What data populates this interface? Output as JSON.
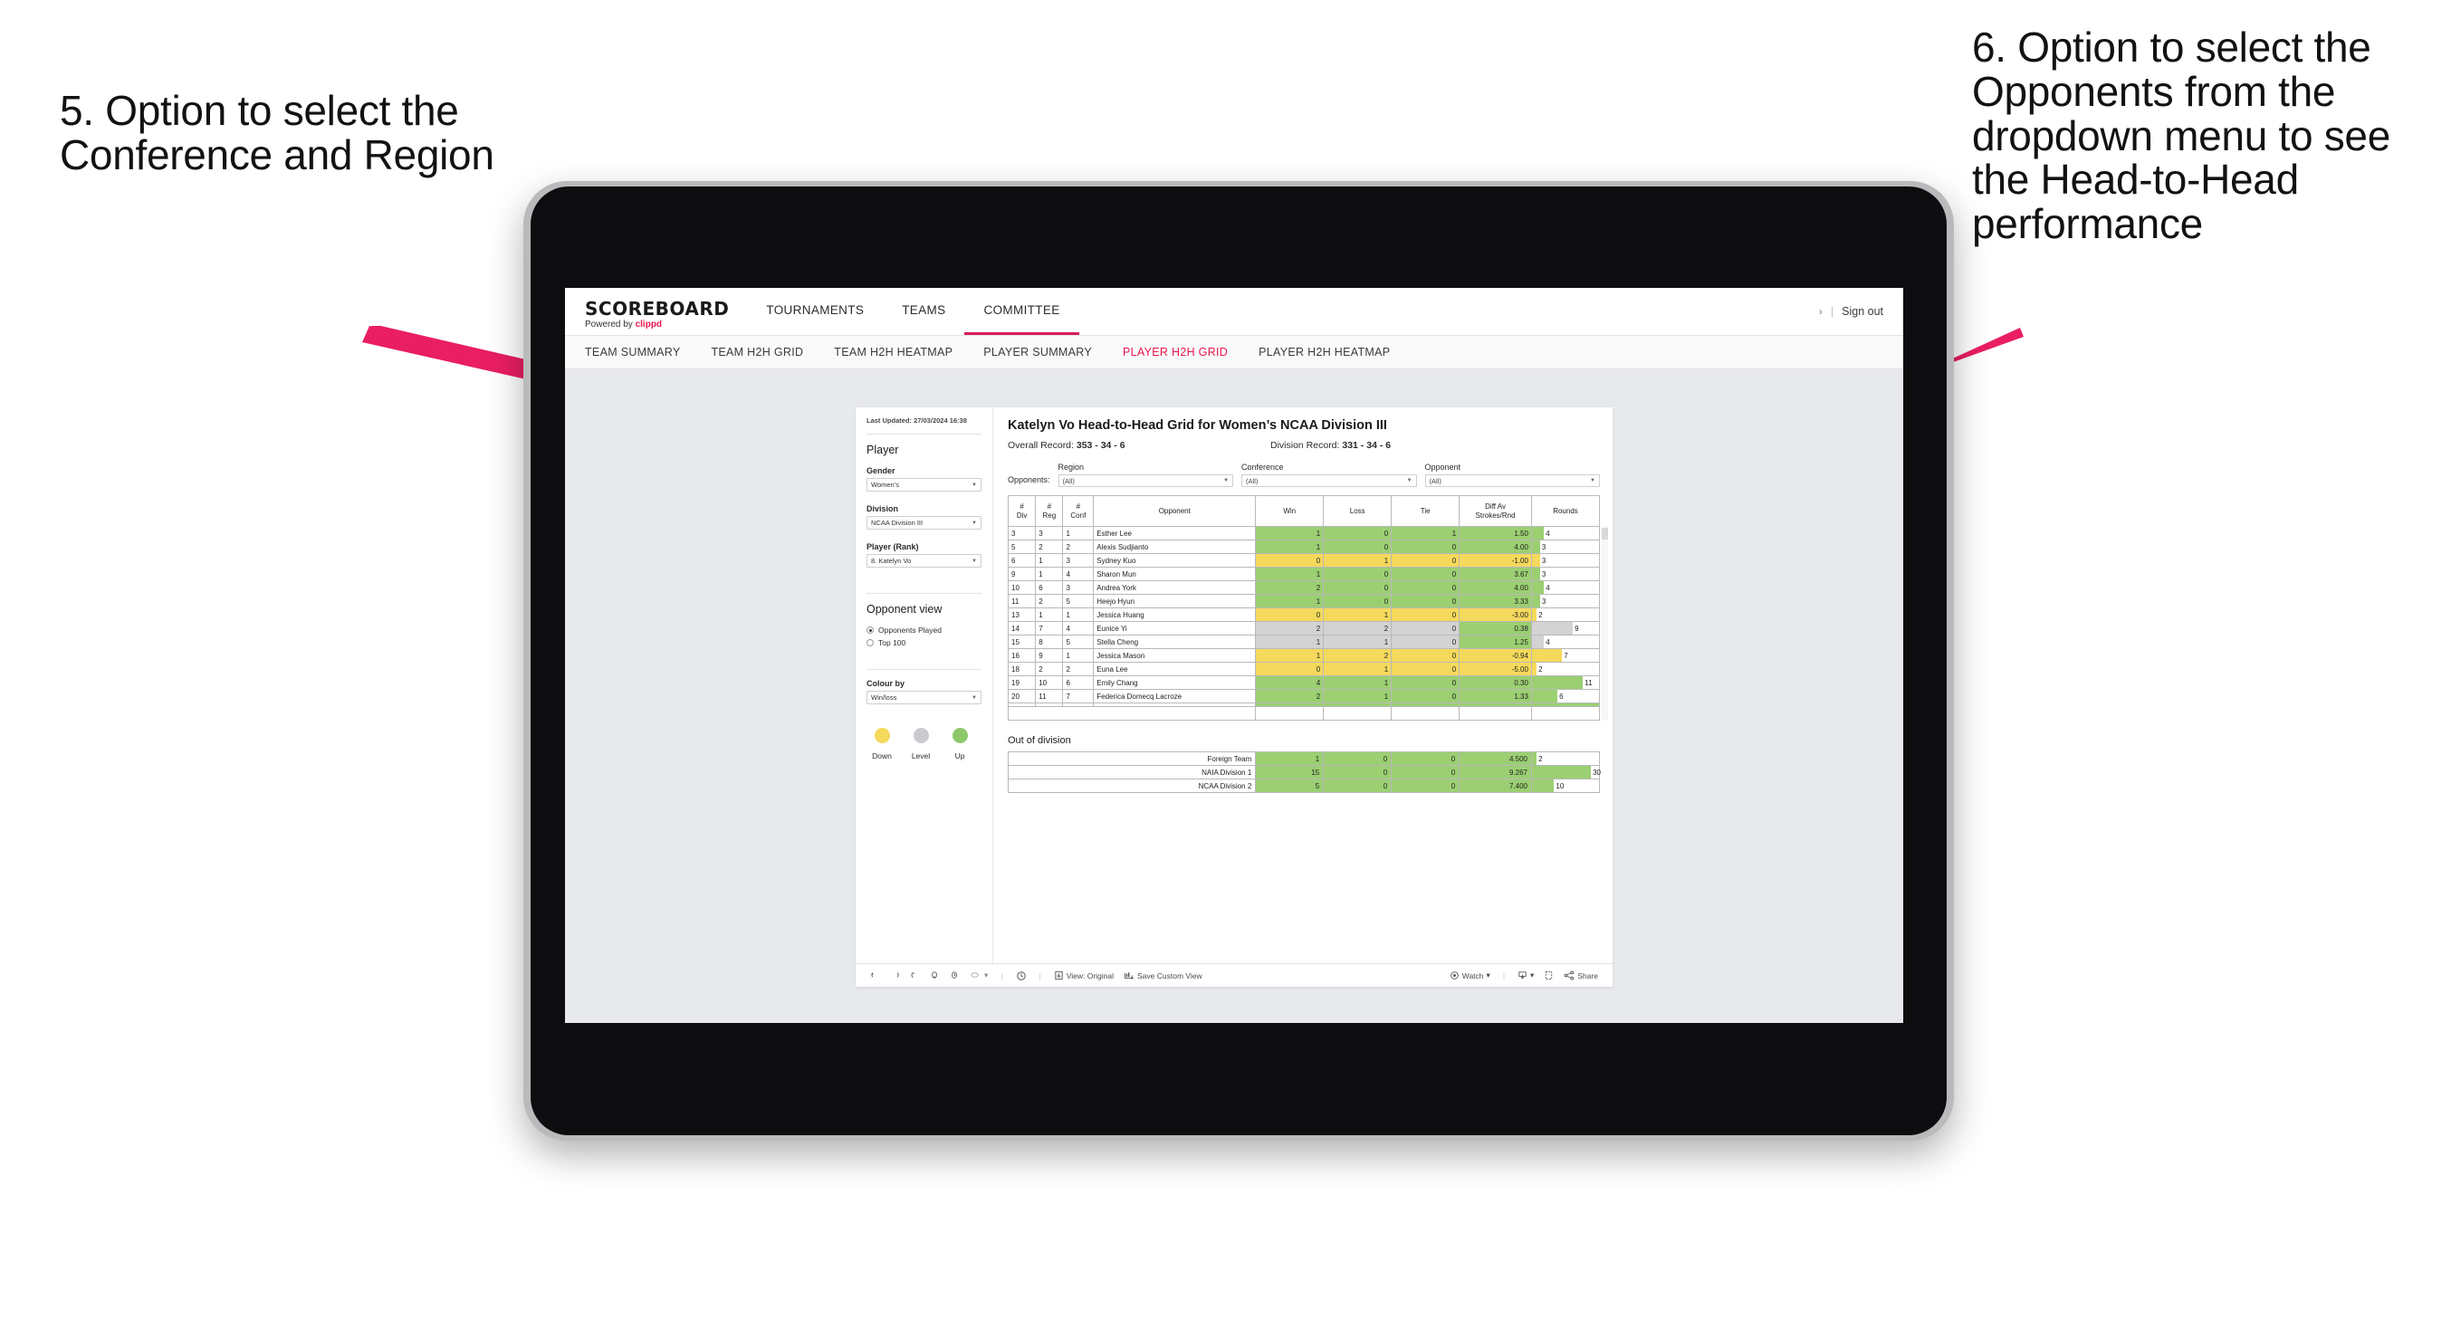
{
  "annotations": {
    "left": "5. Option to select the Conference and Region",
    "right": "6. Option to select the Opponents from the dropdown menu to see the Head-to-Head performance"
  },
  "colors": {
    "accent": "#e8174e",
    "active_tab": "#d81b5e",
    "up_green": "#9bcf72",
    "down_yellow": "#f5d95c",
    "level_grey": "#d3d3d3"
  },
  "header": {
    "logo_title": "SCOREBOARD",
    "logo_sub_prefix": "Powered by ",
    "logo_brand": "clippd",
    "nav": [
      {
        "label": "TOURNAMENTS",
        "active": false
      },
      {
        "label": "TEAMS",
        "active": false
      },
      {
        "label": "COMMITTEE",
        "active": true
      }
    ],
    "chevron": "›",
    "divider": "|",
    "sign_out": "Sign out"
  },
  "subnav": [
    {
      "label": "TEAM SUMMARY",
      "active": false
    },
    {
      "label": "TEAM H2H GRID",
      "active": false
    },
    {
      "label": "TEAM H2H HEATMAP",
      "active": false
    },
    {
      "label": "PLAYER SUMMARY",
      "active": false
    },
    {
      "label": "PLAYER H2H GRID",
      "active": true
    },
    {
      "label": "PLAYER H2H HEATMAP",
      "active": false
    }
  ],
  "sidebar": {
    "last_updated": "Last Updated: 27/03/2024 16:38",
    "player_heading": "Player",
    "fields": [
      {
        "label": "Gender",
        "value": "Women’s"
      },
      {
        "label": "Division",
        "value": "NCAA Division III"
      },
      {
        "label": "Player (Rank)",
        "value": "8. Katelyn Vo"
      }
    ],
    "opponent_view_heading": "Opponent view",
    "opponent_view_options": [
      {
        "label": "Opponents Played",
        "selected": true
      },
      {
        "label": "Top 100",
        "selected": false
      }
    ],
    "colour_by_label": "Colour by",
    "colour_by_value": "Win/loss",
    "legend": [
      {
        "label": "Down",
        "color": "#f5d95c"
      },
      {
        "label": "Level",
        "color": "#c9cbcf"
      },
      {
        "label": "Up",
        "color": "#8dc96a"
      }
    ]
  },
  "main": {
    "title": "Katelyn Vo Head-to-Head Grid for Women’s NCAA Division III",
    "overall_record_label": "Overall Record: ",
    "overall_record_value": "353 - 34 - 6",
    "division_record_label": "Division Record: ",
    "division_record_value": "331 - 34 - 6",
    "opponents_label": "Opponents:",
    "filters": [
      {
        "label": "Region",
        "value": "(All)"
      },
      {
        "label": "Conference",
        "value": "(All)"
      },
      {
        "label": "Opponent",
        "value": "(All)"
      }
    ],
    "columns": [
      "# Div",
      "# Reg",
      "# Conf",
      "Opponent",
      "Win",
      "Loss",
      "Tie",
      "Diff Av Strokes/Rnd",
      "Rounds"
    ],
    "rows": [
      {
        "div": "3",
        "reg": "3",
        "conf": "1",
        "opponent": "Esther Lee",
        "win": "1",
        "loss": "0",
        "tie": "1",
        "diff": "1.50",
        "rounds": "4",
        "fill": "#9bcf72",
        "bar_pct": 18
      },
      {
        "div": "5",
        "reg": "2",
        "conf": "2",
        "opponent": "Alexis Sudjianto",
        "win": "1",
        "loss": "0",
        "tie": "0",
        "diff": "4.00",
        "rounds": "3",
        "fill": "#9bcf72",
        "bar_pct": 12
      },
      {
        "div": "6",
        "reg": "1",
        "conf": "3",
        "opponent": "Sydney Kuo",
        "win": "0",
        "loss": "1",
        "tie": "0",
        "diff": "-1.00",
        "rounds": "3",
        "fill": "#f5d95c",
        "bar_pct": 12
      },
      {
        "div": "9",
        "reg": "1",
        "conf": "4",
        "opponent": "Sharon Mun",
        "win": "1",
        "loss": "0",
        "tie": "0",
        "diff": "3.67",
        "rounds": "3",
        "fill": "#9bcf72",
        "bar_pct": 12
      },
      {
        "div": "10",
        "reg": "6",
        "conf": "3",
        "opponent": "Andrea York",
        "win": "2",
        "loss": "0",
        "tie": "0",
        "diff": "4.00",
        "rounds": "4",
        "fill": "#9bcf72",
        "bar_pct": 18
      },
      {
        "div": "11",
        "reg": "2",
        "conf": "5",
        "opponent": "Heejo Hyun",
        "win": "1",
        "loss": "0",
        "tie": "0",
        "diff": "3.33",
        "rounds": "3",
        "fill": "#9bcf72",
        "bar_pct": 12
      },
      {
        "div": "13",
        "reg": "1",
        "conf": "1",
        "opponent": "Jessica Huang",
        "win": "0",
        "loss": "1",
        "tie": "0",
        "diff": "-3.00",
        "rounds": "2",
        "fill": "#f5d95c",
        "bar_pct": 7
      },
      {
        "div": "14",
        "reg": "7",
        "conf": "4",
        "opponent": "Eunice Yi",
        "win": "2",
        "loss": "2",
        "tie": "0",
        "diff": "0.38",
        "rounds": "9",
        "fill": "#d3d3d3",
        "bar_pct": 61,
        "diff_fill": "#9bcf72"
      },
      {
        "div": "15",
        "reg": "8",
        "conf": "5",
        "opponent": "Stella Cheng",
        "win": "1",
        "loss": "1",
        "tie": "0",
        "diff": "1.25",
        "rounds": "4",
        "fill": "#d3d3d3",
        "bar_pct": 18,
        "diff_fill": "#9bcf72"
      },
      {
        "div": "16",
        "reg": "9",
        "conf": "1",
        "opponent": "Jessica Mason",
        "win": "1",
        "loss": "2",
        "tie": "0",
        "diff": "-0.94",
        "rounds": "7",
        "fill": "#f5d95c",
        "bar_pct": 45
      },
      {
        "div": "18",
        "reg": "2",
        "conf": "2",
        "opponent": "Euna Lee",
        "win": "0",
        "loss": "1",
        "tie": "0",
        "diff": "-5.00",
        "rounds": "2",
        "fill": "#f5d95c",
        "bar_pct": 7
      },
      {
        "div": "19",
        "reg": "10",
        "conf": "6",
        "opponent": "Emily Chang",
        "win": "4",
        "loss": "1",
        "tie": "0",
        "diff": "0.30",
        "rounds": "11",
        "fill": "#9bcf72",
        "bar_pct": 76
      },
      {
        "div": "20",
        "reg": "11",
        "conf": "7",
        "opponent": "Federica Domecq Lacroze",
        "win": "2",
        "loss": "1",
        "tie": "0",
        "diff": "1.33",
        "rounds": "6",
        "fill": "#9bcf72",
        "bar_pct": 38
      }
    ],
    "out_of_division_heading": "Out of division",
    "out_of_division_rows": [
      {
        "name": "Foreign Team",
        "win": "1",
        "loss": "0",
        "tie": "0",
        "diff": "4.500",
        "rounds": "2",
        "fill": "#9bcf72",
        "bar_pct": 7
      },
      {
        "name": "NAIA Division 1",
        "win": "15",
        "loss": "0",
        "tie": "0",
        "diff": "9.267",
        "rounds": "30",
        "fill": "#9bcf72",
        "bar_pct": 88
      },
      {
        "name": "NCAA Division 2",
        "win": "5",
        "loss": "0",
        "tie": "0",
        "diff": "7.400",
        "rounds": "10",
        "fill": "#9bcf72",
        "bar_pct": 33
      }
    ]
  },
  "toolbar": {
    "view_original": "View: Original",
    "save_custom_view": "Save Custom View",
    "watch": "Watch",
    "share": "Share",
    "caret": "▾",
    "sep": "|"
  }
}
